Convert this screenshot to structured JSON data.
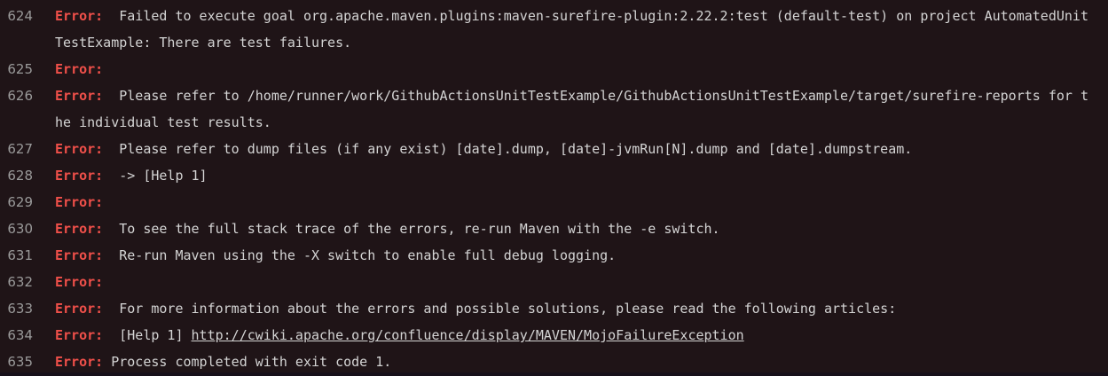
{
  "log": {
    "error_label": "Error:",
    "lines": [
      {
        "num": "624",
        "sep": "  ",
        "text": "Failed to execute goal org.apache.maven.plugins:maven-surefire-plugin:2.22.2:test (default-test) on project AutomatedUnitTestExample: There are test failures."
      },
      {
        "num": "625",
        "sep": "",
        "text": ""
      },
      {
        "num": "626",
        "sep": "  ",
        "text": "Please refer to /home/runner/work/GithubActionsUnitTestExample/GithubActionsUnitTestExample/target/surefire-reports for the individual test results."
      },
      {
        "num": "627",
        "sep": "  ",
        "text": "Please refer to dump files (if any exist) [date].dump, [date]-jvmRun[N].dump and [date].dumpstream."
      },
      {
        "num": "628",
        "sep": "  ",
        "text": "-> [Help 1]"
      },
      {
        "num": "629",
        "sep": "",
        "text": ""
      },
      {
        "num": "630",
        "sep": "  ",
        "text": "To see the full stack trace of the errors, re-run Maven with the -e switch."
      },
      {
        "num": "631",
        "sep": "  ",
        "text": "Re-run Maven using the -X switch to enable full debug logging."
      },
      {
        "num": "632",
        "sep": "",
        "text": ""
      },
      {
        "num": "633",
        "sep": "  ",
        "text": "For more information about the errors and possible solutions, please read the following articles:"
      },
      {
        "num": "634",
        "sep": "  ",
        "text": "[Help 1] ",
        "link": "http://cwiki.apache.org/confluence/display/MAVEN/MojoFailureException"
      },
      {
        "num": "635",
        "sep": " ",
        "text": "Process completed with exit code 1."
      }
    ]
  },
  "colors": {
    "background": "#1f1417",
    "error_label": "#f0504a",
    "line_number": "#9a9a9a",
    "text": "#d4d4d4"
  }
}
